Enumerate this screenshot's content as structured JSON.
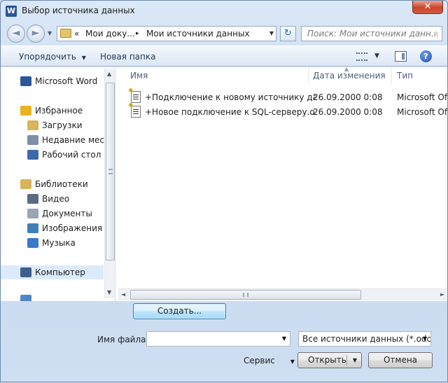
{
  "window": {
    "title": "Выбор источника данных",
    "app_icon_letter": "W",
    "close_glyph": "✕"
  },
  "nav": {
    "back_glyph": "◄",
    "forward_glyph": "►",
    "history_dropdown_glyph": "▼",
    "address": {
      "overflow": "«",
      "crumbs": [
        "Мои доку...",
        "Мои источники данных"
      ],
      "separator": "▸",
      "dropdown_glyph": "▼"
    },
    "refresh_glyph": "↻",
    "search": {
      "placeholder": "Поиск: Мои источники данн...",
      "icon_glyph": "⌕"
    }
  },
  "toolbar": {
    "organize_label": "Упорядочить",
    "organize_dropdown": "▼",
    "new_folder_label": "Новая папка",
    "views_dropdown": "▼",
    "help_glyph": "?"
  },
  "sidebar": {
    "items": [
      {
        "label": "Microsoft Word",
        "icon": "word-icon",
        "color": "#2b5797"
      },
      {
        "label": "Избранное",
        "icon": "star-icon",
        "color": "#e8b320"
      },
      {
        "label": "Загрузки",
        "icon": "downloads-folder-icon",
        "color": "#d8b45a"
      },
      {
        "label": "Недавние места",
        "icon": "recent-places-icon",
        "color": "#7c8fa8"
      },
      {
        "label": "Рабочий стол",
        "icon": "desktop-icon",
        "color": "#3c6aa8"
      },
      {
        "label": "Библиотеки",
        "icon": "libraries-icon",
        "color": "#d8b45a"
      },
      {
        "label": "Видео",
        "icon": "video-icon",
        "color": "#5a6a80"
      },
      {
        "label": "Документы",
        "icon": "documents-icon",
        "color": "#9aa6b6"
      },
      {
        "label": "Изображения",
        "icon": "pictures-icon",
        "color": "#3f7fb8"
      },
      {
        "label": "Музыка",
        "icon": "music-icon",
        "color": "#3a78c8"
      },
      {
        "label": "Компьютер",
        "icon": "computer-icon",
        "color": "#3c5f8f"
      }
    ],
    "scroll_up": "▲",
    "scroll_down": "▼"
  },
  "files": {
    "columns": {
      "name": "Имя",
      "date": "Дата изменения",
      "type": "Тип"
    },
    "sort_caret": "▲",
    "rows": [
      {
        "name": "+Подключение к новому источнику да...",
        "date": "26.09.2000 0:08",
        "type": "Microsoft Of"
      },
      {
        "name": "+Новое подключение к SQL-серверу.o...",
        "date": "26.09.2000 0:08",
        "type": "Microsoft Of"
      }
    ],
    "scroll_left": "◄",
    "scroll_right": "►"
  },
  "bottom": {
    "create_label": "Создать...",
    "filename_label": "Имя файла:",
    "filename_value": "",
    "filetype_value": "Все источники данных (*.odc;*",
    "tools_label": "Сервис",
    "open_label": "Открыть",
    "cancel_label": "Отмена",
    "dropdown_glyph": "▼"
  }
}
